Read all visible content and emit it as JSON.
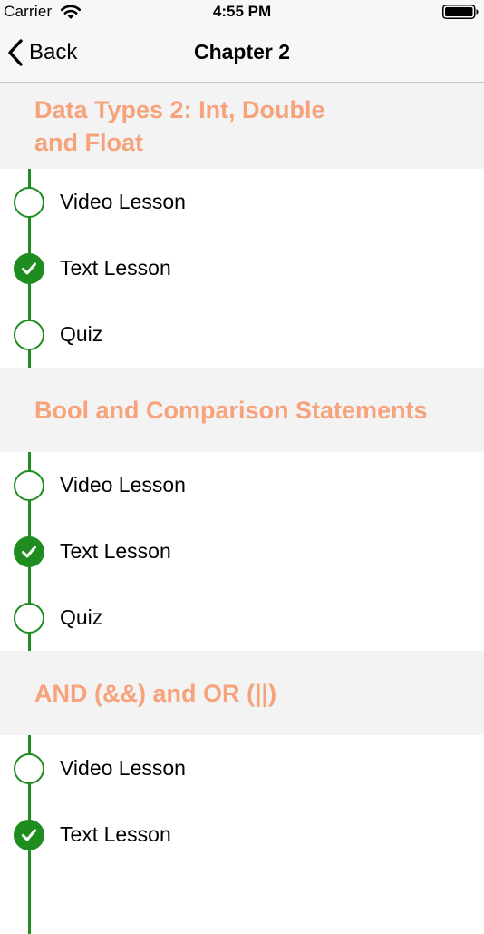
{
  "status_bar": {
    "carrier": "Carrier",
    "time": "4:55 PM"
  },
  "nav": {
    "back_label": "Back",
    "title": "Chapter 2"
  },
  "sections": [
    {
      "title": "Data Types 2: Int, Double and Float",
      "lessons": [
        {
          "label": "Video Lesson",
          "completed": false
        },
        {
          "label": "Text Lesson",
          "completed": true
        },
        {
          "label": "Quiz",
          "completed": false
        }
      ]
    },
    {
      "title": "Bool and Comparison Statements",
      "lessons": [
        {
          "label": "Video Lesson",
          "completed": false
        },
        {
          "label": "Text Lesson",
          "completed": true
        },
        {
          "label": "Quiz",
          "completed": false
        }
      ]
    },
    {
      "title": "AND (&&) and OR (||)",
      "lessons": [
        {
          "label": "Video Lesson",
          "completed": false
        },
        {
          "label": "Text Lesson",
          "completed": true
        }
      ]
    }
  ],
  "colors": {
    "accent_green": "#1e8c1e",
    "section_title_orange": "#f6a37b",
    "section_background": "#f3f3f3",
    "bar_background": "#f7f7f7"
  }
}
